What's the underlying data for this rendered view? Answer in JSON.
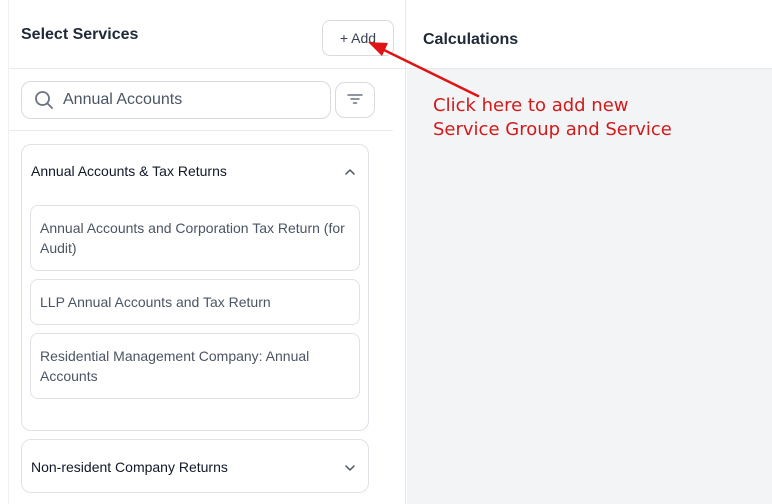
{
  "left_panel": {
    "title": "Select Services",
    "add_label": "+ Add",
    "search": {
      "value": "Annual Accounts",
      "placeholder": "Search"
    }
  },
  "groups": [
    {
      "title": "Annual Accounts & Tax Returns",
      "expanded": true,
      "services": [
        {
          "label": "Annual Accounts and Corporation Tax Return (for Audit)"
        },
        {
          "label": "LLP Annual Accounts and Tax Return"
        },
        {
          "label": "Residential Management Company: Annual Accounts"
        }
      ]
    },
    {
      "title": "Non-resident Company Returns",
      "expanded": false
    }
  ],
  "right_panel": {
    "title": "Calculations"
  },
  "annotation": {
    "line1": "Click here to add new",
    "line2": "Service Group and Service",
    "color": "#d11a1a"
  },
  "icons": {
    "search": "search-icon",
    "filter": "filter-icon",
    "chevron_up": "chevron-up-icon",
    "chevron_down": "chevron-down-icon",
    "arrow": "arrow-icon"
  }
}
